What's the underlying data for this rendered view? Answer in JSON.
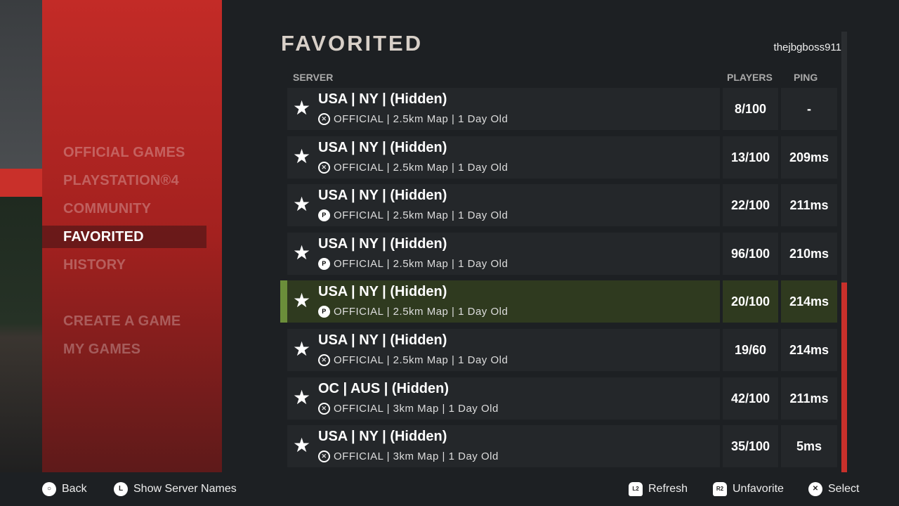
{
  "title": "FAVORITED",
  "username": "thejbgboss911",
  "sidebar": {
    "items": [
      {
        "label": "OFFICIAL GAMES",
        "active": false
      },
      {
        "label": "PLAYSTATION®4",
        "active": false
      },
      {
        "label": "COMMUNITY",
        "active": false
      },
      {
        "label": "FAVORITED",
        "active": true
      },
      {
        "label": "HISTORY",
        "active": false
      },
      {
        "label": "CREATE A GAME",
        "active": false
      },
      {
        "label": "MY GAMES",
        "active": false
      }
    ]
  },
  "columns": {
    "server": "SERVER",
    "players": "PLAYERS",
    "ping": "PING"
  },
  "servers": [
    {
      "name": "USA | NY | (Hidden)",
      "details": "OFFICIAL | 2.5km Map | 1 Day Old",
      "platform": "crossplay-icon",
      "players": "8/100",
      "ping": "-"
    },
    {
      "name": "USA | NY | (Hidden)",
      "details": "OFFICIAL | 2.5km Map | 1 Day Old",
      "platform": "crossplay-icon",
      "players": "13/100",
      "ping": "209ms"
    },
    {
      "name": "USA | NY | (Hidden)",
      "details": "OFFICIAL | 2.5km Map | 1 Day Old",
      "platform": "playstation-icon",
      "players": "22/100",
      "ping": "211ms"
    },
    {
      "name": "USA | NY | (Hidden)",
      "details": "OFFICIAL | 2.5km Map | 1 Day Old",
      "platform": "playstation-icon",
      "players": "96/100",
      "ping": "210ms"
    },
    {
      "name": "USA | NY | (Hidden)",
      "details": "OFFICIAL | 2.5km Map | 1 Day Old",
      "platform": "playstation-icon",
      "players": "20/100",
      "ping": "214ms",
      "selected": true
    },
    {
      "name": "USA | NY | (Hidden)",
      "details": "OFFICIAL | 2.5km Map | 1 Day Old",
      "platform": "crossplay-icon",
      "players": "19/60",
      "ping": "214ms"
    },
    {
      "name": "OC | AUS | (Hidden)",
      "details": "OFFICIAL | 3km Map | 1 Day Old",
      "platform": "crossplay-icon",
      "players": "42/100",
      "ping": "211ms"
    },
    {
      "name": "USA | NY | (Hidden)",
      "details": "OFFICIAL | 3km Map | 1 Day Old",
      "platform": "crossplay-icon",
      "players": "35/100",
      "ping": "5ms"
    }
  ],
  "footer": {
    "back": {
      "glyph": "○",
      "label": "Back"
    },
    "names": {
      "glyph": "L",
      "label": "Show Server Names"
    },
    "refresh": {
      "glyph": "L2",
      "label": "Refresh"
    },
    "unfavorite": {
      "glyph": "R2",
      "label": "Unfavorite"
    },
    "select": {
      "glyph": "✕",
      "label": "Select"
    }
  },
  "colors": {
    "sidebar": "#c32b27",
    "selected_row": "#2f3a1f",
    "selected_accent": "#6b8e3a",
    "scroll_thumb": "#c8302b"
  },
  "scroll_position": {
    "visible_fraction": 0.43,
    "at_end": true
  }
}
